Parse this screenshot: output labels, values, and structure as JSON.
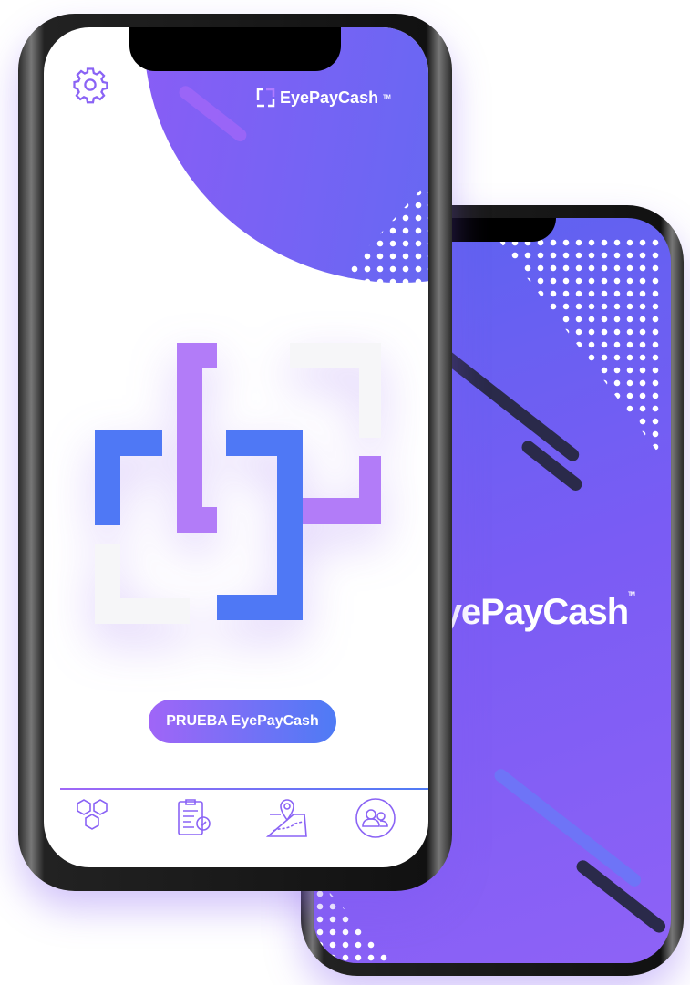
{
  "brand": {
    "name": "EyePayCash",
    "trademark": "TM"
  },
  "back_screen": {
    "brand_text": "EyePayCash",
    "trademark": "TM"
  },
  "front_screen": {
    "header": {
      "settings_icon": "gear-icon",
      "logo_text": "EyePayCash",
      "trademark": "TM"
    },
    "cta_button": {
      "label": "PRUEBA EyePayCash"
    },
    "bottom_nav": [
      {
        "icon": "hexagons-icon"
      },
      {
        "icon": "clipboard-check-icon"
      },
      {
        "icon": "map-pin-icon"
      },
      {
        "icon": "users-icon"
      }
    ]
  },
  "colors": {
    "purple": "#a065f7",
    "blue": "#4e7bf5",
    "frame": "#111111"
  }
}
